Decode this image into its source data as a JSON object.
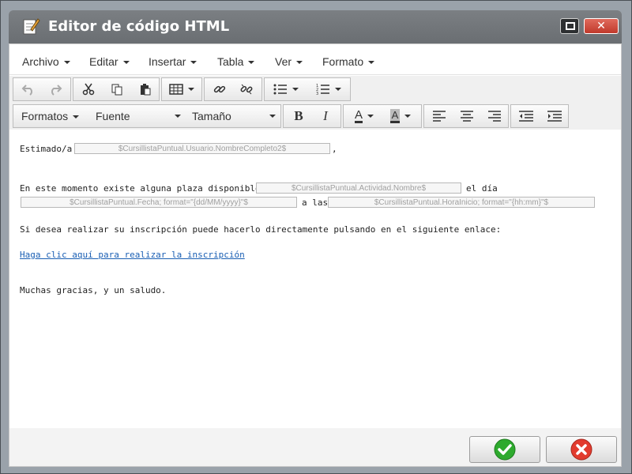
{
  "window": {
    "title": "Editor de código HTML",
    "close_glyph": "✕",
    "icons": {
      "title": "notepad-icon",
      "restore": "restore-icon",
      "close": "close-icon"
    }
  },
  "menubar": {
    "items": [
      {
        "label": "Archivo"
      },
      {
        "label": "Editar"
      },
      {
        "label": "Insertar"
      },
      {
        "label": "Tabla"
      },
      {
        "label": "Ver"
      },
      {
        "label": "Formato"
      }
    ]
  },
  "toolbar": {
    "row1_icons": [
      "undo-icon",
      "redo-icon",
      "cut-icon",
      "copy-icon",
      "paste-icon",
      "table-icon",
      "link-icon",
      "unlink-icon",
      "bullet-list-icon",
      "numbered-list-icon"
    ],
    "selects": {
      "formats": "Formatos",
      "font": "Fuente",
      "size": "Tamaño"
    },
    "bold_glyph": "B",
    "italic_glyph": "I",
    "text_color_glyph": "A",
    "bg_color_glyph": "A",
    "row2_icons": [
      "bold-icon",
      "italic-icon",
      "text-color-icon",
      "background-color-icon",
      "align-left-icon",
      "align-center-icon",
      "align-right-icon",
      "outdent-icon",
      "indent-icon"
    ]
  },
  "document": {
    "greeting_prefix": "Estimado/a",
    "field_nombre": "$CursillistaPuntual.Usuario.NombreCompleto2$",
    "greeting_suffix": ",",
    "line2_prefix": "En este momento existe alguna plaza disponible de",
    "field_actividad": "$CursillistaPuntual.Actividad.Nombre$",
    "line2_mid": "el día",
    "field_fecha": "$CursillistaPuntual.Fecha; format=\"{dd/MM/yyyy}\"$",
    "line3_mid": "a las",
    "field_hora": "$CursillistaPuntual.HoraInicio; format=\"{hh:mm}\"$",
    "line4": "Si desea realizar su inscripción puede hacerlo directamente pulsando en el siguiente enlace:",
    "link_text": "Haga clic aquí para realizar la inscripción",
    "closing": "Muchas gracias, y un saludo."
  },
  "footer": {
    "ok_icon": "check-icon",
    "cancel_icon": "cancel-icon"
  },
  "colors": {
    "ok": "#2eaa2e",
    "cancel": "#e23b2e",
    "link": "#1a5fb4"
  }
}
